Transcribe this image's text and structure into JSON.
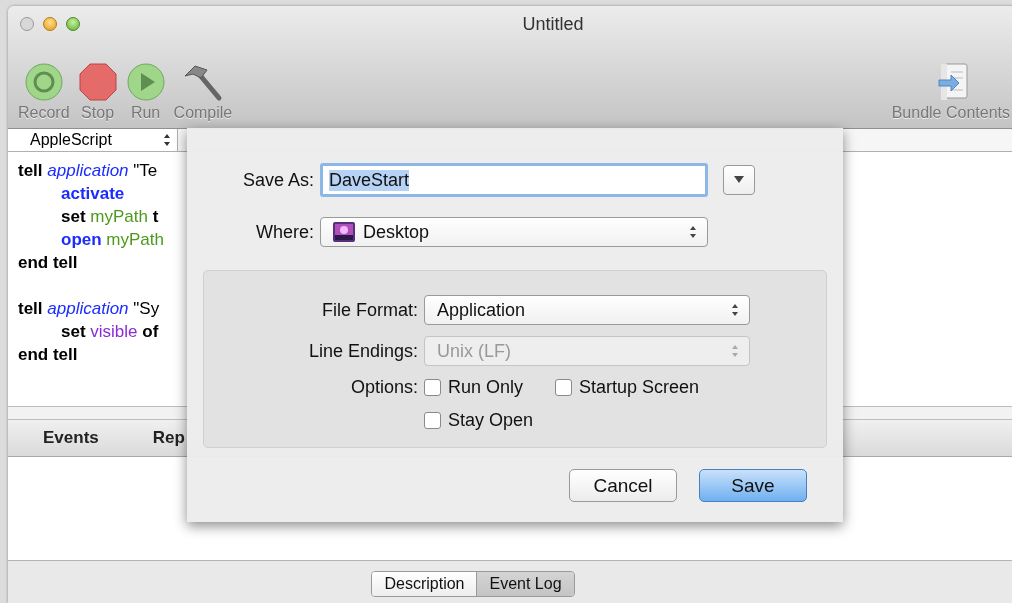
{
  "window": {
    "title": "Untitled"
  },
  "toolbar": {
    "items": [
      {
        "label": "Record",
        "kind": "record"
      },
      {
        "label": "Stop",
        "kind": "stop"
      },
      {
        "label": "Run",
        "kind": "run"
      },
      {
        "label": "Compile",
        "kind": "compile"
      }
    ],
    "right_items": [
      {
        "label": "Bundle Contents",
        "kind": "bundle"
      }
    ]
  },
  "language_popup": {
    "value": "AppleScript"
  },
  "script_blocks": [
    {
      "lines": [
        {
          "indented": false,
          "tokens": [
            {
              "text": "tell",
              "kind": "keyword"
            },
            {
              "text": "application",
              "kind": "class"
            },
            {
              "text": "\"Te",
              "kind": "plain"
            }
          ]
        },
        {
          "indented": true,
          "tokens": [
            {
              "text": "activate",
              "kind": "command"
            }
          ]
        },
        {
          "indented": true,
          "tokens": [
            {
              "text": "set",
              "kind": "keyword"
            },
            {
              "text": "myPath",
              "kind": "variable"
            },
            {
              "text": "t",
              "kind": "keyword"
            }
          ]
        },
        {
          "indented": true,
          "tokens": [
            {
              "text": "open",
              "kind": "command"
            },
            {
              "text": "myPath",
              "kind": "variable"
            }
          ]
        },
        {
          "indented": false,
          "tokens": [
            {
              "text": "end tell",
              "kind": "keyword"
            }
          ]
        }
      ]
    },
    {
      "lines": [
        {
          "indented": false,
          "tokens": [
            {
              "text": "tell",
              "kind": "keyword"
            },
            {
              "text": "application",
              "kind": "class"
            },
            {
              "text": "\"Sy",
              "kind": "plain"
            }
          ]
        },
        {
          "indented": true,
          "tokens": [
            {
              "text": "set",
              "kind": "keyword"
            },
            {
              "text": "visible",
              "kind": "property"
            },
            {
              "text": "of",
              "kind": "keyword"
            }
          ]
        },
        {
          "indented": false,
          "tokens": [
            {
              "text": "end tell",
              "kind": "keyword"
            }
          ]
        }
      ]
    }
  ],
  "log_tabs": [
    {
      "label": "Events"
    },
    {
      "label": "Rep"
    }
  ],
  "view_tabs": [
    {
      "label": "Description",
      "selected": false
    },
    {
      "label": "Event Log",
      "selected": true
    }
  ],
  "save_sheet": {
    "save_as": {
      "label": "Save As:",
      "value": "DaveStart",
      "text_selected": true
    },
    "where": {
      "label": "Where:",
      "value": "Desktop"
    },
    "file_format": {
      "label": "File Format:",
      "value": "Application",
      "disabled": false
    },
    "line_endings": {
      "label": "Line Endings:",
      "value": "Unix (LF)",
      "disabled": true
    },
    "options_label": "Options:",
    "options": [
      {
        "label": "Run Only",
        "checked": false
      },
      {
        "label": "Startup Screen",
        "checked": false
      },
      {
        "label": "Stay Open",
        "checked": false
      }
    ],
    "buttons": [
      {
        "label": "Cancel",
        "default": false
      },
      {
        "label": "Save",
        "default": true
      }
    ]
  }
}
